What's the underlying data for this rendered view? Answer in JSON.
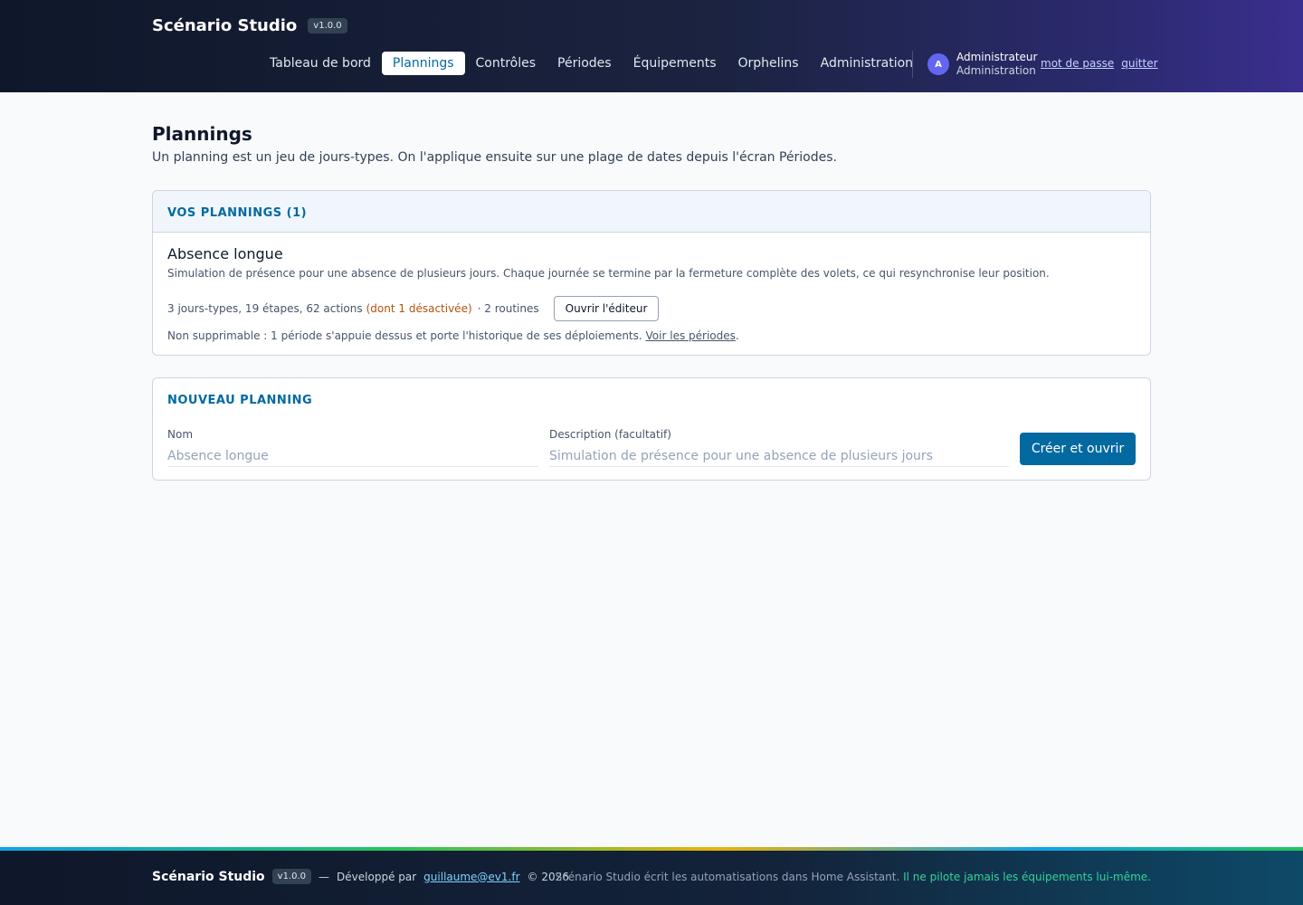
{
  "header": {
    "brand": "Scénario Studio",
    "version": "v1.0.0",
    "nav": [
      {
        "label": "Tableau de bord"
      },
      {
        "label": "Plannings"
      },
      {
        "label": "Contrôles"
      },
      {
        "label": "Périodes"
      },
      {
        "label": "Équipements"
      },
      {
        "label": "Orphelins"
      },
      {
        "label": "Administration"
      }
    ],
    "active_nav": "Plannings",
    "user": {
      "initial": "A",
      "name": "Administrateur",
      "role": "Administration",
      "password_link": "mot de passe",
      "logout_link": "quitter"
    }
  },
  "main": {
    "title": "Plannings",
    "subtitle": "Un planning est un jeu de jours-types. On l'applique ensuite sur une plage de dates depuis l'écran Périodes.",
    "plans_card": {
      "heading": "VOS PLANNINGS (1)",
      "plans": [
        {
          "name": "Absence longue",
          "description": "Simulation de présence pour une absence de plusieurs jours. Chaque journée se termine par la fermeture complète des volets, ce qui resynchronise leur position.",
          "stats": "3 jours-types, 19 étapes, 62 actions",
          "warning": "(dont 1 désactivée)",
          "routines": "· 2 routines",
          "open_button": "Ouvrir l'éditeur",
          "note": "Non supprimable : 1 période s'appuie dessus et porte l'historique de ses déploiements.",
          "note_link": "Voir les périodes",
          "note_end": "."
        }
      ]
    },
    "new_card": {
      "heading": "NOUVEAU PLANNING",
      "name_label": "Nom",
      "name_placeholder": "Absence longue",
      "desc_label": "Description (facultatif)",
      "desc_placeholder": "Simulation de présence pour une absence de plusieurs jours",
      "submit": "Créer et ouvrir"
    }
  },
  "footer": {
    "brand": "Scénario Studio",
    "version": "v1.0.0",
    "dash": "—",
    "dev_text": "Développé par",
    "email": "guillaume@ev1.fr",
    "copyright": "© 2026",
    "right_text": "Scénario Studio écrit les automatisations dans Home Assistant.",
    "right_highlight": "Il ne pilote jamais les équipements lui-même."
  },
  "colors": {
    "accent": "#0369a1",
    "warning": "#b45309",
    "avatar": "#6366f1",
    "footer_highlight": "#34d399"
  }
}
